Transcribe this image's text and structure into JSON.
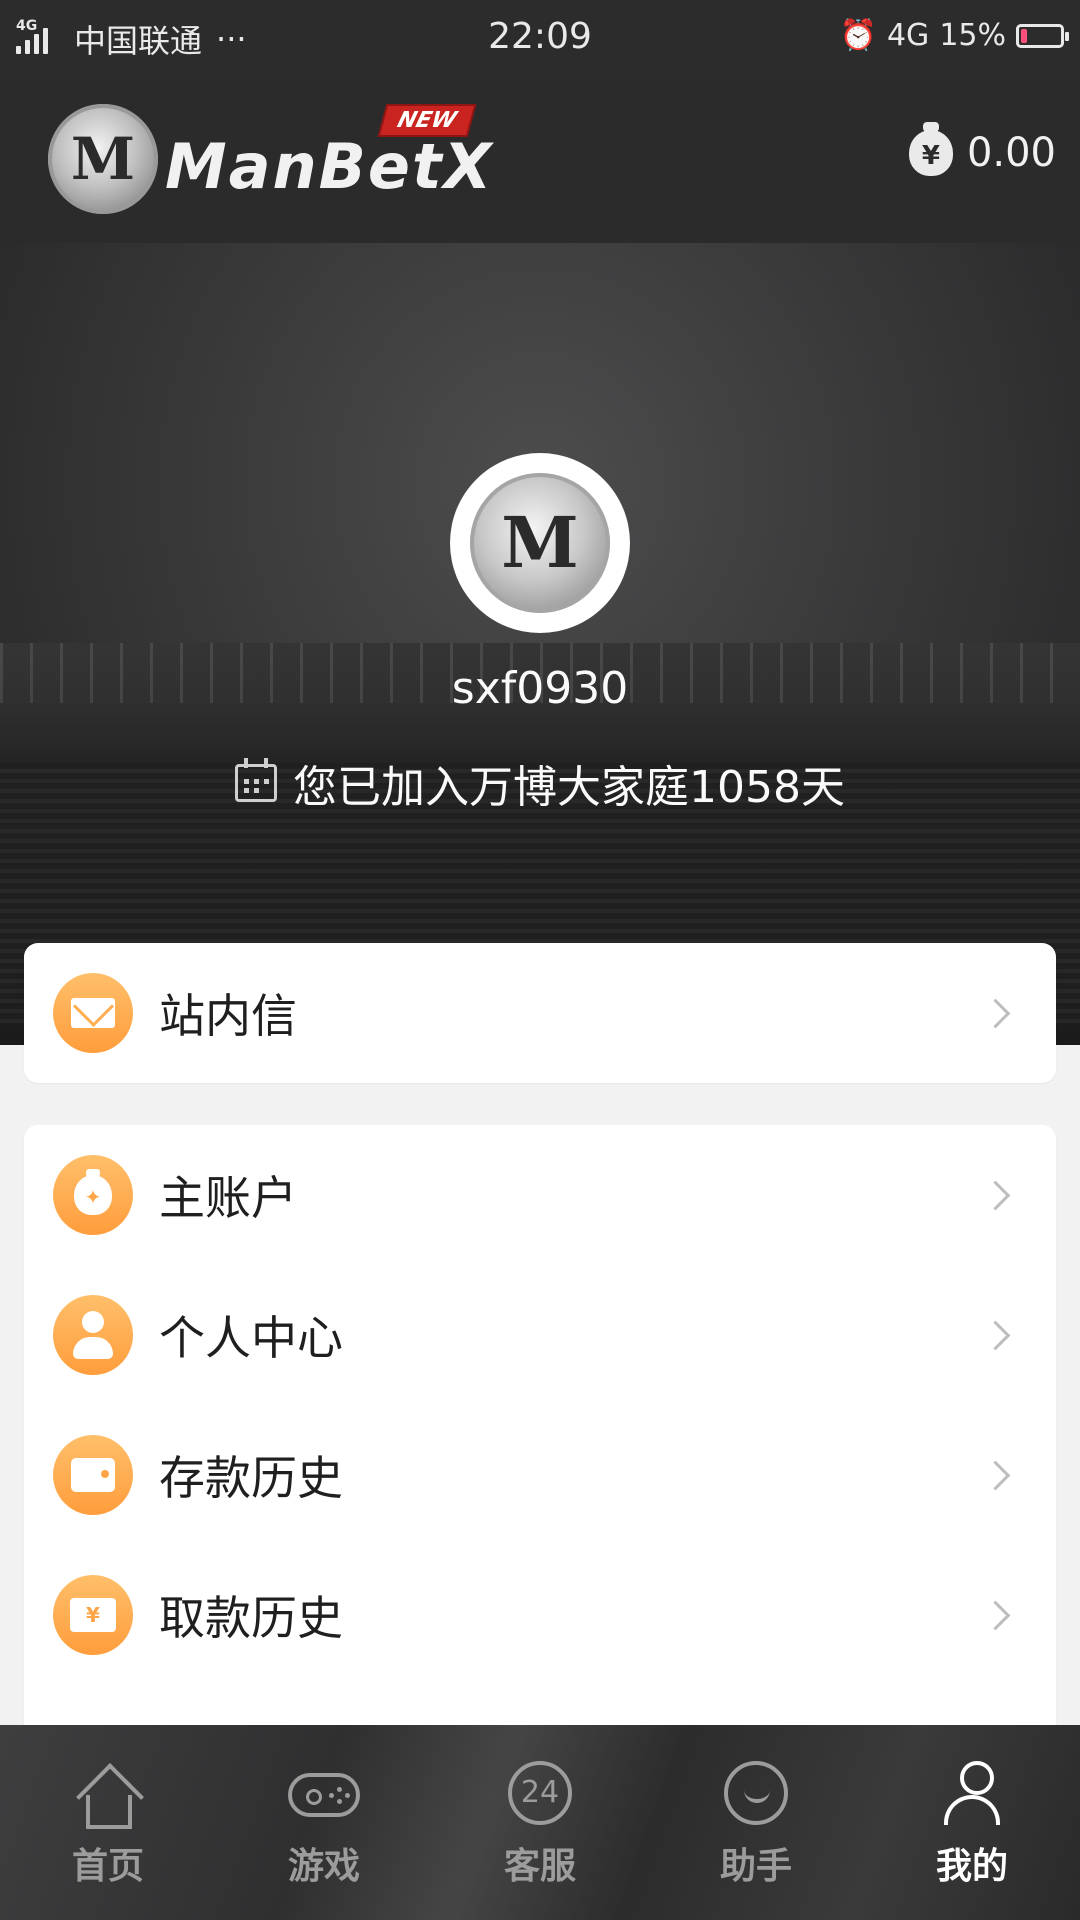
{
  "status_bar": {
    "network_tag": "4G",
    "carrier": "中国联通",
    "dots": "···",
    "time": "22:09",
    "network": "4G",
    "battery": "15%",
    "battery_level": 0.15,
    "alarm_icon": "alarm-clock-icon"
  },
  "header": {
    "brand": "ManBetX",
    "new_badge": "NEW",
    "balance": "0.00",
    "balance_icon": "money-bag-icon",
    "currency_symbol": "¥"
  },
  "profile": {
    "username": "sxf0930",
    "join_text": "您已加入万博大家庭1058天",
    "calendar_icon": "calendar-icon"
  },
  "menu_primary": [
    {
      "label": "站内信",
      "icon": "envelope-icon"
    }
  ],
  "menu_secondary": [
    {
      "label": "主账户",
      "icon": "money-bag-icon"
    },
    {
      "label": "个人中心",
      "icon": "user-icon"
    },
    {
      "label": "存款历史",
      "icon": "wallet-icon"
    },
    {
      "label": "取款历史",
      "icon": "ticket-icon"
    }
  ],
  "tabbar": {
    "items": [
      {
        "label": "首页",
        "icon": "home-icon",
        "active": false
      },
      {
        "label": "游戏",
        "icon": "gamepad-icon",
        "active": false
      },
      {
        "label": "客服",
        "icon": "support-24-icon",
        "badge_text": "24",
        "active": false
      },
      {
        "label": "助手",
        "icon": "assistant-smile-icon",
        "active": false
      },
      {
        "label": "我的",
        "icon": "profile-icon",
        "active": true
      }
    ]
  },
  "colors": {
    "accent_orange": "#ff9d3c",
    "header_bg": "#2b2b2c",
    "battery_low": "#ff4f7b"
  }
}
